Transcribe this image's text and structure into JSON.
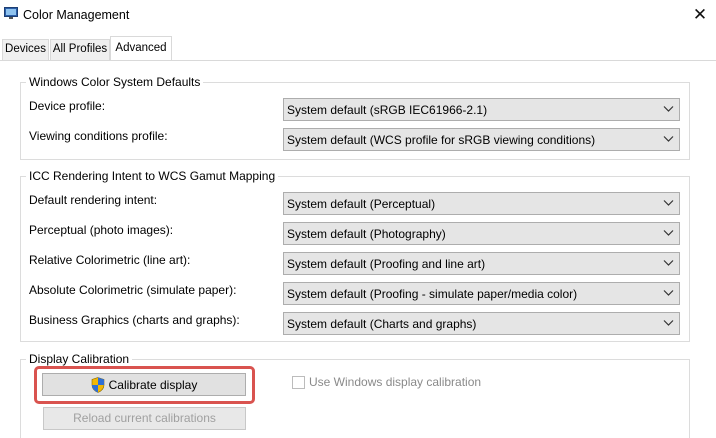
{
  "window": {
    "title": "Color Management",
    "close_symbol": "✕"
  },
  "tabs": [
    {
      "label": "Devices",
      "active": false
    },
    {
      "label": "All Profiles",
      "active": false
    },
    {
      "label": "Advanced",
      "active": true
    }
  ],
  "wcs_defaults": {
    "legend": "Windows Color System Defaults",
    "rows": [
      {
        "label": "Device profile:",
        "value": "System default (sRGB IEC61966-2.1)"
      },
      {
        "label": "Viewing conditions profile:",
        "value": "System default (WCS profile for sRGB viewing conditions)"
      }
    ]
  },
  "icc_mapping": {
    "legend": "ICC Rendering Intent to WCS Gamut Mapping",
    "rows": [
      {
        "label": "Default rendering intent:",
        "value": "System default (Perceptual)"
      },
      {
        "label": "Perceptual (photo images):",
        "value": "System default (Photography)"
      },
      {
        "label": "Relative Colorimetric (line art):",
        "value": "System default (Proofing and line art)"
      },
      {
        "label": "Absolute Colorimetric (simulate paper):",
        "value": "System default (Proofing - simulate paper/media color)"
      },
      {
        "label": "Business Graphics (charts and graphs):",
        "value": "System default (Charts and graphs)"
      }
    ]
  },
  "display_calibration": {
    "legend": "Display Calibration",
    "calibrate_button": "Calibrate display",
    "reload_button": "Reload current calibrations",
    "use_windows_calibration": {
      "label": "Use Windows display calibration",
      "checked": false,
      "enabled": false
    }
  },
  "icons": {
    "app": "monitor-icon",
    "shield": "uac-shield-icon",
    "dropdown": "chevron-down-icon"
  },
  "colors": {
    "highlight": "#d9534f",
    "combo_bg": "#e5e5e5",
    "button_bg": "#e1e1e1"
  }
}
